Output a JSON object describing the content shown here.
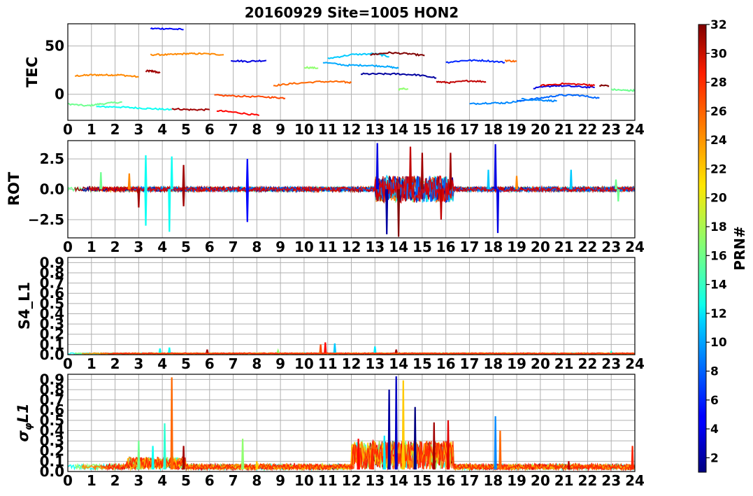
{
  "chart_data": {
    "title": "20160929 Site=1005 HON2",
    "colorbar": {
      "label": "PRN#",
      "ticks": [
        2,
        4,
        6,
        8,
        10,
        12,
        14,
        16,
        18,
        20,
        22,
        24,
        26,
        28,
        30,
        32
      ],
      "range": [
        1,
        32
      ],
      "colormap": "jet"
    },
    "x_ticks": [
      0,
      1,
      2,
      3,
      4,
      5,
      6,
      7,
      8,
      9,
      10,
      11,
      12,
      13,
      14,
      15,
      16,
      17,
      18,
      19,
      20,
      21,
      22,
      23,
      24
    ],
    "grid": true,
    "panels": [
      {
        "name": "tec",
        "type": "line",
        "ylabel": "TEC",
        "xlim": [
          0,
          24
        ],
        "ylim": [
          -27,
          73
        ],
        "yticks": [
          0,
          50
        ],
        "ytick_labels": [
          "0",
          "50"
        ],
        "series": [
          {
            "prn": 31,
            "x": [
              3.3,
              3.6,
              3.9
            ],
            "y": [
              24,
              24,
              22
            ]
          },
          {
            "prn": 24,
            "x": [
              0.3,
              1.0,
              1.6,
              2.2,
              3.0
            ],
            "y": [
              19,
              20,
              20,
              20,
              18
            ]
          },
          {
            "prn": 16,
            "x": [
              0.0,
              0.8,
              1.4,
              2.3
            ],
            "y": [
              -10,
              -12,
              -10,
              -8
            ]
          },
          {
            "prn": 13,
            "x": [
              1.2,
              2.0,
              2.8,
              3.6,
              4.4
            ],
            "y": [
              -13,
              -13,
              -14,
              -15,
              -16
            ]
          },
          {
            "prn": 5,
            "x": [
              3.5,
              4.2,
              4.9
            ],
            "y": [
              68,
              68,
              67
            ]
          },
          {
            "prn": 24,
            "x": [
              3.5,
              4.3,
              5.0,
              5.7,
              6.6
            ],
            "y": [
              41,
              41,
              42,
              42,
              41
            ]
          },
          {
            "prn": 31,
            "x": [
              4.4,
              5.2,
              6.0
            ],
            "y": [
              -15,
              -16,
              -16
            ]
          },
          {
            "prn": 28,
            "x": [
              6.3,
              7.2,
              8.1
            ],
            "y": [
              -17,
              -19,
              -22
            ]
          },
          {
            "prn": 26,
            "x": [
              6.2,
              7.3,
              8.5,
              9.2
            ],
            "y": [
              -1,
              -2,
              -3,
              -4
            ]
          },
          {
            "prn": 4,
            "x": [
              6.9,
              7.6,
              8.4
            ],
            "y": [
              35,
              34,
              35
            ]
          },
          {
            "prn": 25,
            "x": [
              8.7,
              9.5,
              10.6,
              11.5,
              12.0
            ],
            "y": [
              9,
              11,
              13,
              13,
              12
            ]
          },
          {
            "prn": 17,
            "x": [
              10.0,
              10.6
            ],
            "y": [
              28,
              27
            ]
          },
          {
            "prn": 10,
            "x": [
              10.8,
              11.8,
              12.6,
              13.4,
              14.0
            ],
            "y": [
              33,
              30,
              30,
              29,
              27
            ]
          },
          {
            "prn": 11,
            "x": [
              11.0,
              12.0,
              13.0,
              13.6
            ],
            "y": [
              37,
              41,
              42,
              39
            ]
          },
          {
            "prn": 32,
            "x": [
              12.8,
              13.6,
              14.4,
              15.1
            ],
            "y": [
              41,
              43,
              42,
              40
            ]
          },
          {
            "prn": 2,
            "x": [
              12.4,
              13.2,
              14.0,
              14.8,
              15.6
            ],
            "y": [
              21,
              21,
              21,
              20,
              17
            ]
          },
          {
            "prn": 17,
            "x": [
              14.0,
              14.4
            ],
            "y": [
              5,
              6
            ]
          },
          {
            "prn": 30,
            "x": [
              15.6,
              16.2,
              17.0,
              17.7
            ],
            "y": [
              13,
              12,
              14,
              13
            ]
          },
          {
            "prn": 6,
            "x": [
              16.0,
              16.8,
              17.6,
              18.5
            ],
            "y": [
              33,
              35,
              35,
              33
            ]
          },
          {
            "prn": 25,
            "x": [
              18.5,
              19.0
            ],
            "y": [
              35,
              34
            ]
          },
          {
            "prn": 9,
            "x": [
              17.0,
              17.8,
              18.5,
              19.2
            ],
            "y": [
              -10,
              -9,
              -9,
              -7
            ]
          },
          {
            "prn": 8,
            "x": [
              19.0,
              20.0,
              20.8,
              21.6,
              22.5
            ],
            "y": [
              -7,
              -4,
              -1,
              -1,
              -4
            ]
          },
          {
            "prn": 9,
            "x": [
              19.2,
              20.0,
              20.7
            ],
            "y": [
              -5,
              -6,
              -7
            ]
          },
          {
            "prn": 4,
            "x": [
              19.7,
              20.6,
              21.5,
              22.3
            ],
            "y": [
              6,
              9,
              8,
              7
            ]
          },
          {
            "prn": 29,
            "x": [
              20.0,
              21.0,
              21.9,
              22.3
            ],
            "y": [
              9,
              11,
              10,
              9
            ]
          },
          {
            "prn": 32,
            "x": [
              22.5,
              22.9
            ],
            "y": [
              9,
              9
            ]
          },
          {
            "prn": 16,
            "x": [
              23.0,
              23.6,
              24.0
            ],
            "y": [
              5,
              4,
              4
            ]
          }
        ]
      },
      {
        "name": "rot",
        "type": "line",
        "ylabel": "ROT",
        "xlim": [
          0,
          24
        ],
        "ylim": [
          -4,
          4
        ],
        "yticks": [
          -2.5,
          0.0,
          2.5
        ],
        "ytick_labels": [
          "−2.5",
          "0.0",
          "2.5"
        ],
        "spikes": [
          {
            "prn": 16,
            "x": 1.4,
            "y": 1.4
          },
          {
            "prn": 24,
            "x": 2.6,
            "y": 1.3
          },
          {
            "prn": 13,
            "x": 3.3,
            "y": 2.8
          },
          {
            "prn": 13,
            "x": 3.3,
            "y": -3.0
          },
          {
            "prn": 31,
            "x": 3.0,
            "y": -1.5
          },
          {
            "prn": 13,
            "x": 4.4,
            "y": 2.7
          },
          {
            "prn": 13,
            "x": 4.3,
            "y": -3.5
          },
          {
            "prn": 31,
            "x": 4.9,
            "y": 2.0
          },
          {
            "prn": 31,
            "x": 4.9,
            "y": -1.4
          },
          {
            "prn": 5,
            "x": 7.6,
            "y": 2.5
          },
          {
            "prn": 5,
            "x": 7.6,
            "y": -2.7
          },
          {
            "prn": 4,
            "x": 13.1,
            "y": 3.8
          },
          {
            "prn": 2,
            "x": 13.5,
            "y": -3.7
          },
          {
            "prn": 32,
            "x": 14.0,
            "y": -3.9
          },
          {
            "prn": 30,
            "x": 14.5,
            "y": 3.5
          },
          {
            "prn": 31,
            "x": 15.0,
            "y": 3.0
          },
          {
            "prn": 30,
            "x": 15.8,
            "y": -2.5
          },
          {
            "prn": 31,
            "x": 16.2,
            "y": 3.0
          },
          {
            "prn": 4,
            "x": 18.1,
            "y": 3.7
          },
          {
            "prn": 4,
            "x": 18.2,
            "y": -3.6
          },
          {
            "prn": 11,
            "x": 17.8,
            "y": 1.6
          },
          {
            "prn": 24,
            "x": 19.0,
            "y": 1.1
          },
          {
            "prn": 11,
            "x": 21.3,
            "y": 1.6
          },
          {
            "prn": 16,
            "x": 23.2,
            "y": 0.8
          },
          {
            "prn": 16,
            "x": 23.3,
            "y": -1.0
          }
        ]
      },
      {
        "name": "s4",
        "type": "line",
        "ylabel": "S4_L1",
        "xlim": [
          0,
          24
        ],
        "ylim": [
          0,
          0.95
        ],
        "yticks": [
          0.0,
          0.1,
          0.2,
          0.3,
          0.4,
          0.5,
          0.6,
          0.7,
          0.8,
          0.9
        ],
        "ytick_labels": [
          "0.0",
          "0.1",
          "0.2",
          "0.3",
          "0.4",
          "0.5",
          "0.6",
          "0.7",
          "0.8",
          "0.9"
        ],
        "spikes": [
          {
            "prn": 13,
            "x": 3.9,
            "y": 0.06
          },
          {
            "prn": 13,
            "x": 4.3,
            "y": 0.07
          },
          {
            "prn": 31,
            "x": 5.9,
            "y": 0.05
          },
          {
            "prn": 17,
            "x": 8.9,
            "y": 0.04
          },
          {
            "prn": 26,
            "x": 10.7,
            "y": 0.1
          },
          {
            "prn": 28,
            "x": 10.9,
            "y": 0.12
          },
          {
            "prn": 11,
            "x": 11.3,
            "y": 0.11
          },
          {
            "prn": 12,
            "x": 13.0,
            "y": 0.08
          },
          {
            "prn": 31,
            "x": 13.9,
            "y": 0.05
          },
          {
            "prn": 14,
            "x": 23.0,
            "y": 0.03
          }
        ]
      },
      {
        "name": "sigma",
        "type": "line",
        "ylabel": "σ_φ L1",
        "xlim": [
          0,
          24
        ],
        "ylim": [
          0,
          0.95
        ],
        "yticks": [
          0.0,
          0.1,
          0.2,
          0.3,
          0.4,
          0.5,
          0.6,
          0.7,
          0.8,
          0.9
        ],
        "ytick_labels": [
          "0.0",
          "0.1",
          "0.2",
          "0.3",
          "0.4",
          "0.5",
          "0.6",
          "0.7",
          "0.8",
          "0.9"
        ],
        "spikes": [
          {
            "prn": 16,
            "x": 3.0,
            "y": 0.3
          },
          {
            "prn": 13,
            "x": 3.6,
            "y": 0.25
          },
          {
            "prn": 14,
            "x": 4.1,
            "y": 0.47
          },
          {
            "prn": 25,
            "x": 4.4,
            "y": 0.92
          },
          {
            "prn": 31,
            "x": 4.9,
            "y": 0.25
          },
          {
            "prn": 17,
            "x": 7.4,
            "y": 0.32
          },
          {
            "prn": 22,
            "x": 8.0,
            "y": 0.1
          },
          {
            "prn": 28,
            "x": 12.3,
            "y": 0.32
          },
          {
            "prn": 27,
            "x": 12.9,
            "y": 0.22
          },
          {
            "prn": 12,
            "x": 13.4,
            "y": 0.35
          },
          {
            "prn": 2,
            "x": 13.6,
            "y": 0.8
          },
          {
            "prn": 3,
            "x": 13.9,
            "y": 0.93
          },
          {
            "prn": 22,
            "x": 14.2,
            "y": 0.89
          },
          {
            "prn": 1,
            "x": 14.7,
            "y": 0.63
          },
          {
            "prn": 31,
            "x": 15.5,
            "y": 0.48
          },
          {
            "prn": 29,
            "x": 16.1,
            "y": 0.5
          },
          {
            "prn": 9,
            "x": 18.1,
            "y": 0.54
          },
          {
            "prn": 25,
            "x": 18.3,
            "y": 0.4
          },
          {
            "prn": 27,
            "x": 23.9,
            "y": 0.25
          },
          {
            "prn": 30,
            "x": 21.2,
            "y": 0.1
          }
        ]
      }
    ]
  }
}
